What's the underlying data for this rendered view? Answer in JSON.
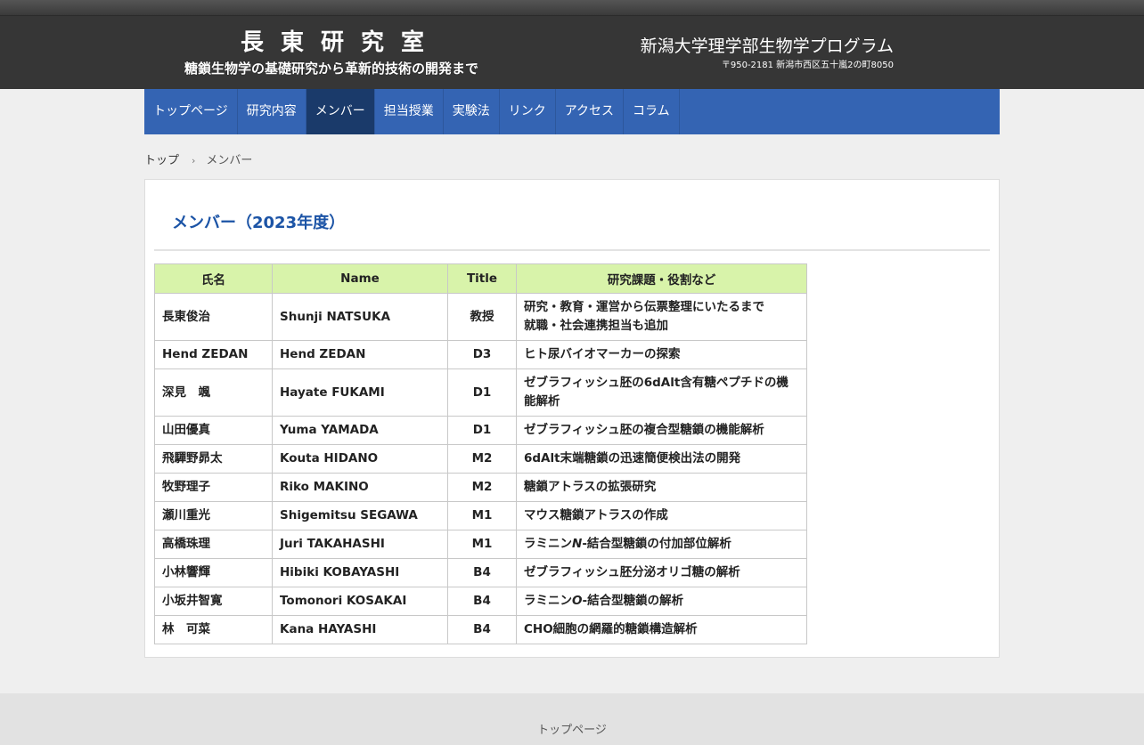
{
  "header": {
    "lab_title": "長東研究室",
    "lab_subtitle": "糖鎖生物学の基礎研究から革新的技術の開発まで",
    "university": "新潟大学理学部生物学プログラム",
    "address": "〒950-2181 新潟市西区五十嵐2の町8050"
  },
  "nav": {
    "items": [
      {
        "label": "トップページ"
      },
      {
        "label": "研究内容"
      },
      {
        "label": "メンバー"
      },
      {
        "label": "担当授業"
      },
      {
        "label": "実験法"
      },
      {
        "label": "リンク"
      },
      {
        "label": "アクセス"
      },
      {
        "label": "コラム"
      }
    ],
    "active": "メンバー"
  },
  "breadcrumb": {
    "home": "トップ",
    "separator": "›",
    "current": "メンバー"
  },
  "page": {
    "title": "メンバー（2023年度）"
  },
  "table": {
    "headers": [
      "氏名",
      "Name",
      "Title",
      "研究課題・役割など"
    ],
    "rows": [
      {
        "jp": "長東俊治",
        "en": "Shunji NATSUKA",
        "title": "教授",
        "research": "研究・教育・運営から伝票整理にいたるまで",
        "research2": "就職・社会連携担当も追加"
      },
      {
        "jp": "Hend ZEDAN",
        "en": "Hend ZEDAN",
        "title": "D3",
        "research": "ヒト尿バイオマーカーの探索"
      },
      {
        "jp": "深見　颯",
        "en": "Hayate FUKAMI",
        "title": "D1",
        "research": "ゼブラフィッシュ胚の6dAlt含有糖ペプチドの機能解析"
      },
      {
        "jp": "山田優真",
        "en": "Yuma YAMADA",
        "title": "D1",
        "research": "ゼブラフィッシュ胚の複合型糖鎖の機能解析"
      },
      {
        "jp": "飛驒野昴太",
        "en": "Kouta HIDANO",
        "title": "M2",
        "research": "6dAlt末端糖鎖の迅速簡便検出法の開発"
      },
      {
        "jp": "牧野理子",
        "en": "Riko MAKINO",
        "title": "M2",
        "research": "糖鎖アトラスの拡張研究"
      },
      {
        "jp": "瀬川重光",
        "en": "Shigemitsu SEGAWA",
        "title": "M1",
        "research": "マウス糖鎖アトラスの作成"
      },
      {
        "jp": "高橋珠理",
        "en": "Juri TAKAHASHI",
        "title": "M1",
        "research_pre": "ラミニン",
        "research_it": "N",
        "research_post": "-結合型糖鎖の付加部位解析"
      },
      {
        "jp": "小林響輝",
        "en": "Hibiki KOBAYASHI",
        "title": "B4",
        "research": "ゼブラフィッシュ胚分泌オリゴ糖の解析"
      },
      {
        "jp": "小坂井智寛",
        "en": "Tomonori KOSAKAI",
        "title": "B4",
        "research_pre": "ラミニン",
        "research_it": "O",
        "research_post": "-結合型糖鎖の解析"
      },
      {
        "jp": "林　可菜",
        "en": "Kana HAYASHI",
        "title": "B4",
        "research": "CHO細胞の網羅的糖鎖構造解析"
      }
    ]
  },
  "footer": {
    "link": "トップページ"
  }
}
